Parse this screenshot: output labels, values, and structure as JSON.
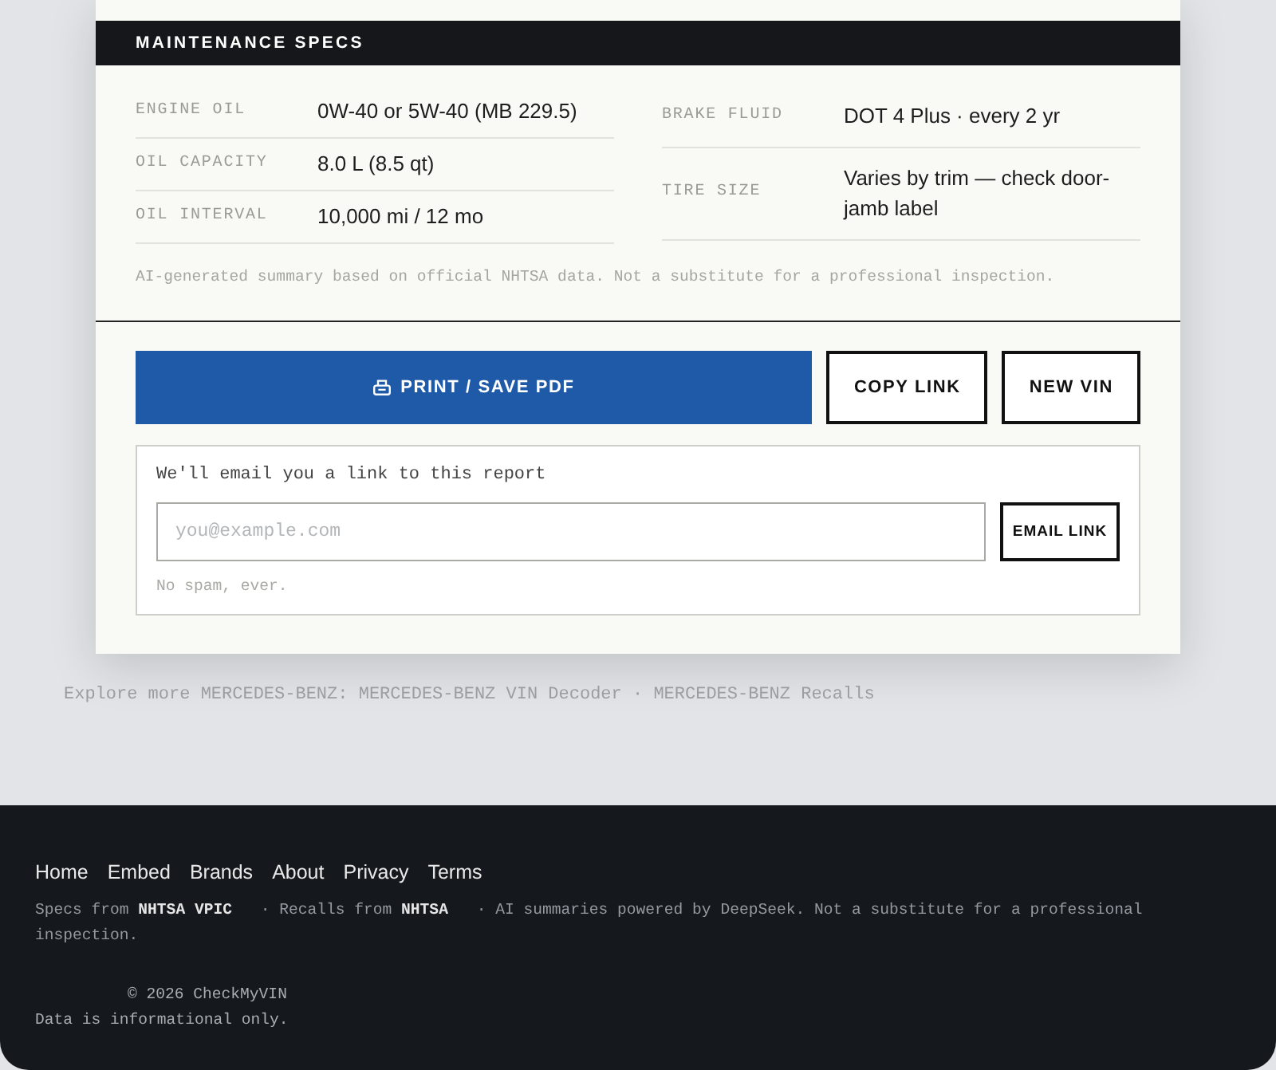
{
  "specs": {
    "title": "MAINTENANCE SPECS",
    "columns": [
      {
        "rows": [
          {
            "label": "ENGINE OIL",
            "value": "0W-40 or 5W-40 (MB 229.5)"
          },
          {
            "label": "OIL CAPACITY",
            "value": "8.0 L (8.5 qt)"
          },
          {
            "label": "OIL INTERVAL",
            "value": "10,000 mi / 12 mo"
          }
        ]
      },
      {
        "rows": [
          {
            "label": "BRAKE FLUID",
            "value": "DOT 4 Plus · every 2 yr"
          },
          {
            "label": "TIRE SIZE",
            "value": "Varies by trim — check door-jamb label"
          }
        ]
      }
    ],
    "disclaimer": "AI-generated summary based on official NHTSA data. Not a substitute for a professional inspection."
  },
  "actions": [
    {
      "kind": "primary",
      "label": "PRINT / SAVE PDF"
    },
    {
      "kind": "outline",
      "label": "COPY LINK"
    },
    {
      "kind": "outline",
      "label": "NEW VIN"
    }
  ],
  "email_form": {
    "prompt": "We'll email you a link to this report",
    "placeholder": "you@example.com",
    "button": "EMAIL LINK",
    "note": "No spam, ever."
  },
  "explore": {
    "prefix": "Explore more MERCEDES-BENZ:",
    "separator": "·",
    "links": [
      "MERCEDES-BENZ VIN Decoder",
      "MERCEDES-BENZ Recalls"
    ]
  },
  "footer": {
    "nav": [
      "Home",
      "Embed",
      "Brands",
      "About",
      "Privacy",
      "Terms"
    ],
    "credits": [
      {
        "kind": "text",
        "text": "Specs from "
      },
      {
        "kind": "link",
        "text": "NHTSA VPIC"
      },
      {
        "kind": "text",
        "text": " · Recalls from "
      },
      {
        "kind": "link",
        "text": "NHTSA"
      },
      {
        "kind": "text",
        "text": " · AI summaries powered by DeepSeek. Not a substitute for a professional inspection."
      }
    ],
    "copyright": "© 2026 CheckMyVIN",
    "notice": "Data is informational only."
  }
}
